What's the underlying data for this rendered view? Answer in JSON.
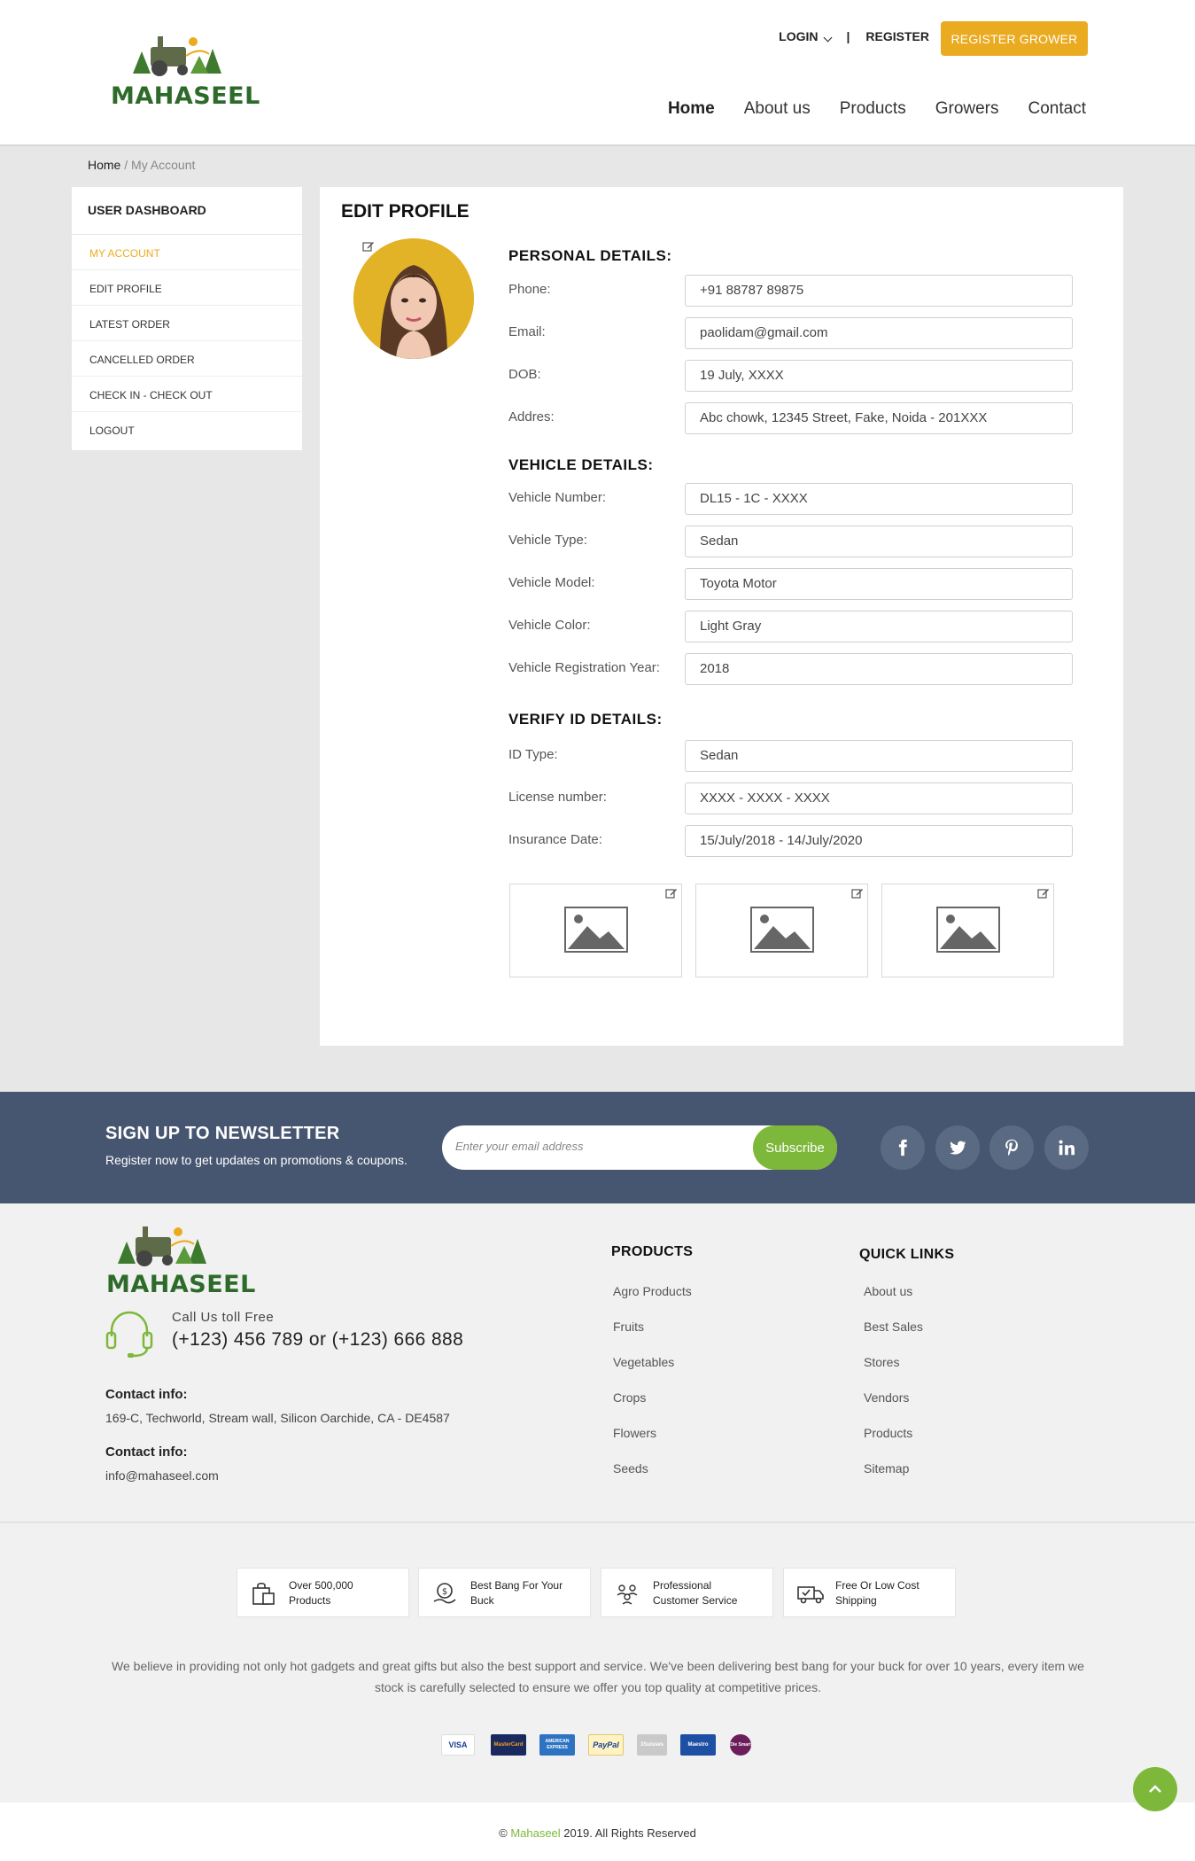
{
  "header": {
    "logo_text": "MAHASEEL",
    "login": "LOGIN",
    "sep": "|",
    "register": "REGISTER",
    "register_grower": "REGISTER GROWER",
    "nav": [
      "Home",
      "About us",
      "Products",
      "Growers",
      "Contact"
    ]
  },
  "breadcrumb": {
    "home": "Home",
    "sep": " / ",
    "current": "My Account"
  },
  "sidebar": {
    "title": "USER DASHBOARD",
    "items": [
      "MY ACCOUNT",
      "EDIT PROFILE",
      "LATEST ORDER",
      "CANCELLED ORDER",
      "CHECK IN - CHECK OUT",
      "LOGOUT"
    ],
    "active_index": 0
  },
  "profile": {
    "title": "EDIT PROFILE",
    "personal_title": "PERSONAL DETAILS:",
    "personal": [
      {
        "label": "Phone:",
        "value": "+91 88787 89875"
      },
      {
        "label": "Email:",
        "value": "paolidam@gmail.com"
      },
      {
        "label": "DOB:",
        "value": "19 July, XXXX"
      },
      {
        "label": "Addres:",
        "value": "Abc chowk, 12345 Street, Fake, Noida - 201XXX"
      }
    ],
    "vehicle_title": "VEHICLE DETAILS:",
    "vehicle": [
      {
        "label": "Vehicle Number:",
        "value": "DL15 - 1C - XXXX"
      },
      {
        "label": "Vehicle Type:",
        "value": "Sedan"
      },
      {
        "label": "Vehicle Model:",
        "value": "Toyota Motor"
      },
      {
        "label": "Vehicle Color:",
        "value": "Light Gray"
      },
      {
        "label": "Vehicle Registration Year:",
        "value": "2018"
      }
    ],
    "verify_title": "VERIFY ID DETAILS:",
    "verify": [
      {
        "label": "ID Type:",
        "value": "Sedan"
      },
      {
        "label": "License number:",
        "value": "XXXX - XXXX - XXXX"
      },
      {
        "label": "Insurance Date:",
        "value": "15/July/2018 - 14/July/2020"
      }
    ]
  },
  "newsletter": {
    "title": "SIGN UP TO NEWSLETTER",
    "subtitle": "Register now to get updates on promotions & coupons.",
    "placeholder": "Enter your email address",
    "button": "Subscribe",
    "social": [
      "facebook-icon",
      "twitter-icon",
      "pinterest-icon",
      "linkedin-icon"
    ]
  },
  "footer": {
    "logo_text": "MAHASEEL",
    "call_label": "Call Us toll Free",
    "call_number": "(+123) 456 789 or (+123) 666 888",
    "contact_label_1": "Contact info:",
    "contact_address": "169-C, Techworld, Stream wall, Silicon Oarchide, CA - DE4587",
    "contact_label_2": "Contact info:",
    "contact_email": "info@mahaseel.com",
    "products_title": "PRODUCTS",
    "products": [
      "Agro Products",
      "Fruits",
      "Vegetables",
      "Crops",
      "Flowers",
      "Seeds"
    ],
    "quick_title": "QUICK LINKS",
    "quick": [
      "About us",
      "Best Sales",
      "Stores",
      "Vendors",
      "Products",
      "Sitemap"
    ]
  },
  "features": [
    {
      "line1": "Over 500,000",
      "line2": "Products"
    },
    {
      "line1": "Best Bang For Your",
      "line2": "Buck"
    },
    {
      "line1": "Professional",
      "line2": "Customer Service"
    },
    {
      "line1": "Free Or Low Cost",
      "line2": "Shipping"
    }
  ],
  "about_text": "We believe in providing not only hot gadgets and great gifts but also the best support and service. We've been delivering best bang for your buck for over 10 years, every item we stock is carefully selected to ensure we offer you top quality at competitive prices.",
  "payments": [
    "VISA",
    "MasterCard",
    "AMERICAN EXPRESS",
    "PayPal",
    "3Suisses",
    "Maestro",
    "Die Smart"
  ],
  "copyright": {
    "prefix": "© ",
    "brand": "Mahaseel",
    "suffix": " 2019. All Rights Reserved"
  },
  "colors": {
    "accent": "#ebab20",
    "green": "#7db83a",
    "newsletter_bg": "#475670"
  }
}
